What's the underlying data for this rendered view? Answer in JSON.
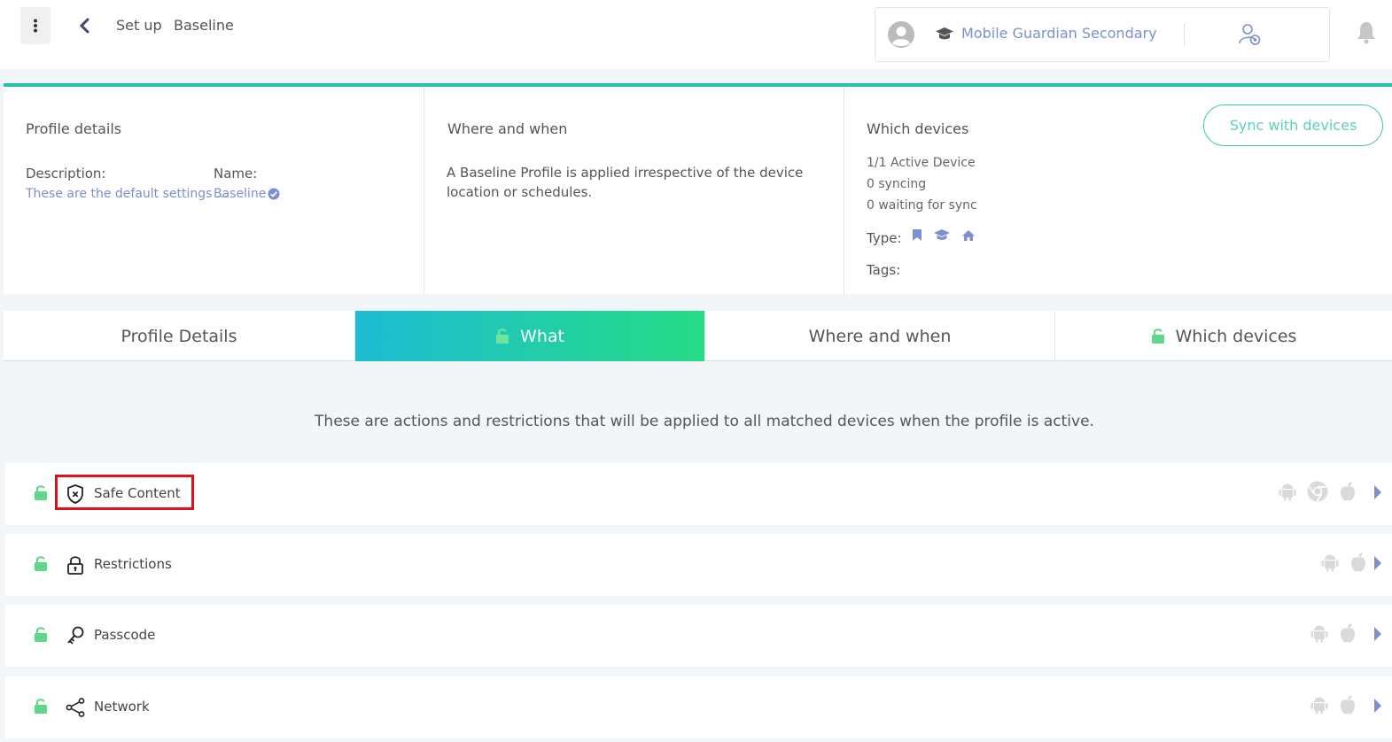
{
  "header": {
    "breadcrumb": [
      "Set up",
      "Baseline"
    ],
    "organization": "Mobile Guardian Secondary"
  },
  "summary": {
    "profile_details": {
      "title": "Profile details",
      "description_label": "Description:",
      "description_value": "These are the default settings ...",
      "name_label": "Name:",
      "name_value": "Baseline"
    },
    "where_when": {
      "title": "Where and when",
      "text": "A Baseline Profile is applied irrespective of the device location or schedules."
    },
    "which_devices": {
      "title": "Which devices",
      "sync_button": "Sync with devices",
      "active": "1/1 Active Device",
      "syncing": "0 syncing",
      "waiting": "0 waiting for sync",
      "type_label": "Type:",
      "type_icons": [
        "bookmark-icon",
        "graduation-cap-icon",
        "home-icon"
      ],
      "tags_label": "Tags:"
    }
  },
  "tabs": [
    {
      "label": "Profile Details",
      "active": false,
      "lock": false
    },
    {
      "label": "What",
      "active": true,
      "lock": true
    },
    {
      "label": "Where and when",
      "active": false,
      "lock": false
    },
    {
      "label": "Which devices",
      "active": false,
      "lock": true
    }
  ],
  "intro": "These are actions and restrictions that will be applied to all matched devices when the profile is active.",
  "rows": [
    {
      "label": "Safe Content",
      "icon": "shield-x-icon",
      "platforms": [
        "android-icon",
        "chrome-icon",
        "apple-icon"
      ],
      "highlighted": true
    },
    {
      "label": "Restrictions",
      "icon": "padlock-icon",
      "platforms": [
        "android-icon",
        "apple-icon"
      ]
    },
    {
      "label": "Passcode",
      "icon": "key-icon",
      "platforms": [
        "android-icon",
        "apple-icon"
      ]
    },
    {
      "label": "Network",
      "icon": "share-network-icon",
      "platforms": [
        "android-icon",
        "apple-icon"
      ]
    }
  ],
  "colors": {
    "accent_teal": "#22c4a9",
    "link_blue": "#7d8fd0",
    "lock_green": "#5fd88a",
    "highlight_red": "#e3101b"
  }
}
